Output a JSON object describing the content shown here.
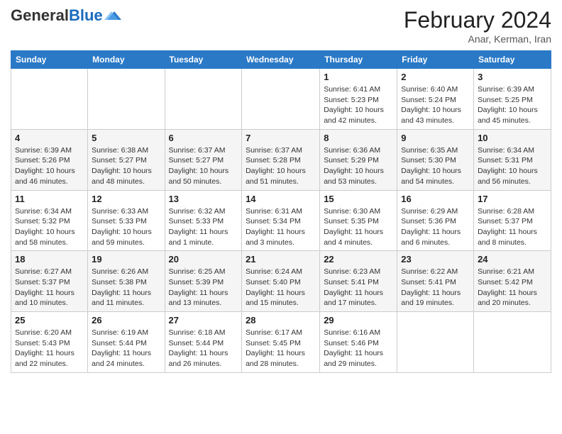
{
  "logo": {
    "general": "General",
    "blue": "Blue"
  },
  "title": "February 2024",
  "location": "Anar, Kerman, Iran",
  "days_of_week": [
    "Sunday",
    "Monday",
    "Tuesday",
    "Wednesday",
    "Thursday",
    "Friday",
    "Saturday"
  ],
  "weeks": [
    [
      {
        "day": "",
        "info": ""
      },
      {
        "day": "",
        "info": ""
      },
      {
        "day": "",
        "info": ""
      },
      {
        "day": "",
        "info": ""
      },
      {
        "day": "1",
        "info": "Sunrise: 6:41 AM\nSunset: 5:23 PM\nDaylight: 10 hours and 42 minutes."
      },
      {
        "day": "2",
        "info": "Sunrise: 6:40 AM\nSunset: 5:24 PM\nDaylight: 10 hours and 43 minutes."
      },
      {
        "day": "3",
        "info": "Sunrise: 6:39 AM\nSunset: 5:25 PM\nDaylight: 10 hours and 45 minutes."
      }
    ],
    [
      {
        "day": "4",
        "info": "Sunrise: 6:39 AM\nSunset: 5:26 PM\nDaylight: 10 hours and 46 minutes."
      },
      {
        "day": "5",
        "info": "Sunrise: 6:38 AM\nSunset: 5:27 PM\nDaylight: 10 hours and 48 minutes."
      },
      {
        "day": "6",
        "info": "Sunrise: 6:37 AM\nSunset: 5:27 PM\nDaylight: 10 hours and 50 minutes."
      },
      {
        "day": "7",
        "info": "Sunrise: 6:37 AM\nSunset: 5:28 PM\nDaylight: 10 hours and 51 minutes."
      },
      {
        "day": "8",
        "info": "Sunrise: 6:36 AM\nSunset: 5:29 PM\nDaylight: 10 hours and 53 minutes."
      },
      {
        "day": "9",
        "info": "Sunrise: 6:35 AM\nSunset: 5:30 PM\nDaylight: 10 hours and 54 minutes."
      },
      {
        "day": "10",
        "info": "Sunrise: 6:34 AM\nSunset: 5:31 PM\nDaylight: 10 hours and 56 minutes."
      }
    ],
    [
      {
        "day": "11",
        "info": "Sunrise: 6:34 AM\nSunset: 5:32 PM\nDaylight: 10 hours and 58 minutes."
      },
      {
        "day": "12",
        "info": "Sunrise: 6:33 AM\nSunset: 5:33 PM\nDaylight: 10 hours and 59 minutes."
      },
      {
        "day": "13",
        "info": "Sunrise: 6:32 AM\nSunset: 5:33 PM\nDaylight: 11 hours and 1 minute."
      },
      {
        "day": "14",
        "info": "Sunrise: 6:31 AM\nSunset: 5:34 PM\nDaylight: 11 hours and 3 minutes."
      },
      {
        "day": "15",
        "info": "Sunrise: 6:30 AM\nSunset: 5:35 PM\nDaylight: 11 hours and 4 minutes."
      },
      {
        "day": "16",
        "info": "Sunrise: 6:29 AM\nSunset: 5:36 PM\nDaylight: 11 hours and 6 minutes."
      },
      {
        "day": "17",
        "info": "Sunrise: 6:28 AM\nSunset: 5:37 PM\nDaylight: 11 hours and 8 minutes."
      }
    ],
    [
      {
        "day": "18",
        "info": "Sunrise: 6:27 AM\nSunset: 5:37 PM\nDaylight: 11 hours and 10 minutes."
      },
      {
        "day": "19",
        "info": "Sunrise: 6:26 AM\nSunset: 5:38 PM\nDaylight: 11 hours and 11 minutes."
      },
      {
        "day": "20",
        "info": "Sunrise: 6:25 AM\nSunset: 5:39 PM\nDaylight: 11 hours and 13 minutes."
      },
      {
        "day": "21",
        "info": "Sunrise: 6:24 AM\nSunset: 5:40 PM\nDaylight: 11 hours and 15 minutes."
      },
      {
        "day": "22",
        "info": "Sunrise: 6:23 AM\nSunset: 5:41 PM\nDaylight: 11 hours and 17 minutes."
      },
      {
        "day": "23",
        "info": "Sunrise: 6:22 AM\nSunset: 5:41 PM\nDaylight: 11 hours and 19 minutes."
      },
      {
        "day": "24",
        "info": "Sunrise: 6:21 AM\nSunset: 5:42 PM\nDaylight: 11 hours and 20 minutes."
      }
    ],
    [
      {
        "day": "25",
        "info": "Sunrise: 6:20 AM\nSunset: 5:43 PM\nDaylight: 11 hours and 22 minutes."
      },
      {
        "day": "26",
        "info": "Sunrise: 6:19 AM\nSunset: 5:44 PM\nDaylight: 11 hours and 24 minutes."
      },
      {
        "day": "27",
        "info": "Sunrise: 6:18 AM\nSunset: 5:44 PM\nDaylight: 11 hours and 26 minutes."
      },
      {
        "day": "28",
        "info": "Sunrise: 6:17 AM\nSunset: 5:45 PM\nDaylight: 11 hours and 28 minutes."
      },
      {
        "day": "29",
        "info": "Sunrise: 6:16 AM\nSunset: 5:46 PM\nDaylight: 11 hours and 29 minutes."
      },
      {
        "day": "",
        "info": ""
      },
      {
        "day": "",
        "info": ""
      }
    ]
  ]
}
